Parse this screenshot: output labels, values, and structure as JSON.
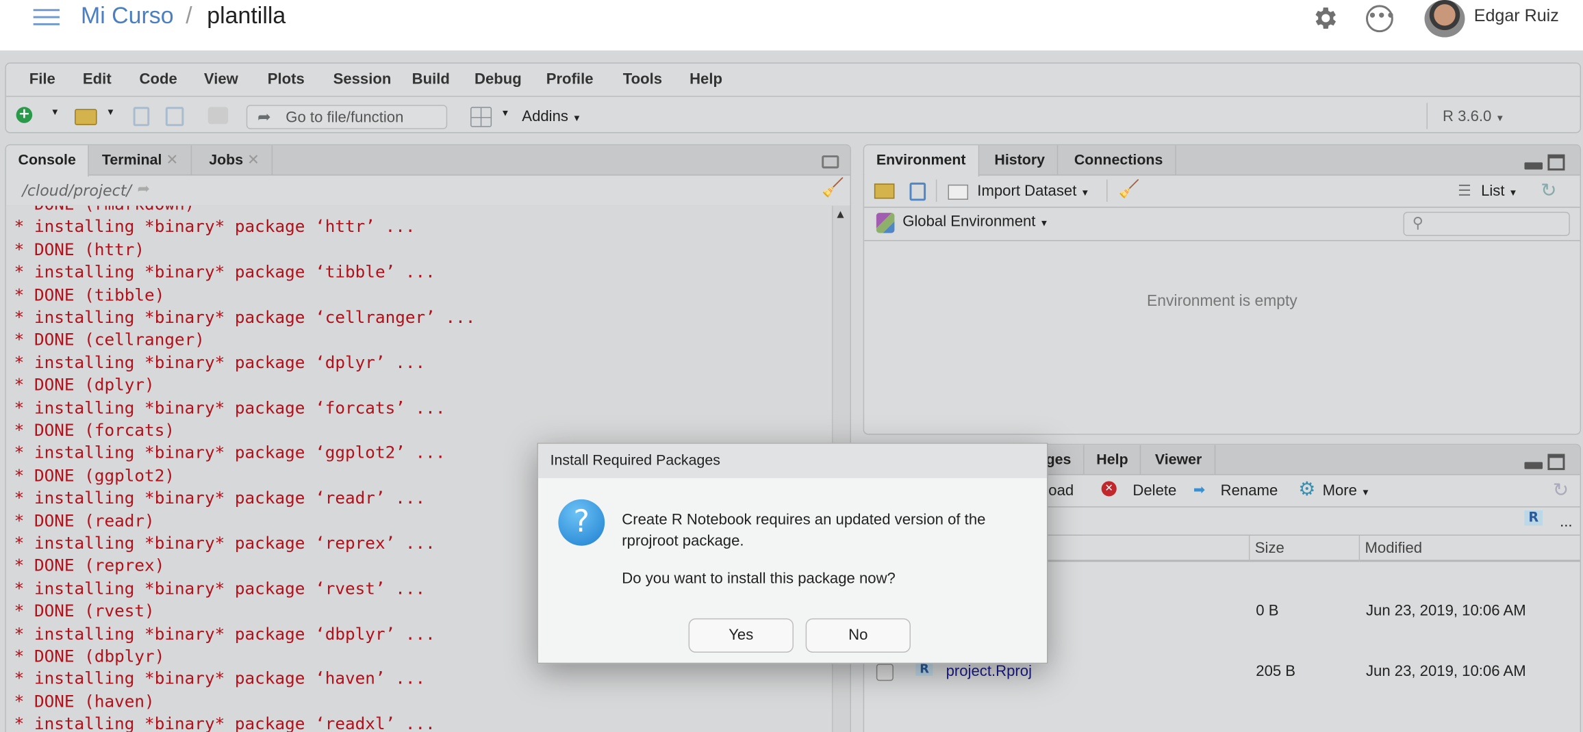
{
  "header": {
    "course": "Mi Curso",
    "separator": "/",
    "project": "plantilla",
    "user": "Edgar Ruiz"
  },
  "menu": [
    "File",
    "Edit",
    "Code",
    "View",
    "Plots",
    "Session",
    "Build",
    "Debug",
    "Profile",
    "Tools",
    "Help"
  ],
  "toolbar": {
    "goto_placeholder": "Go to file/function",
    "addins": "Addins",
    "r_version": "R 3.6.0"
  },
  "left_pane": {
    "tabs": [
      "Console",
      "Terminal",
      "Jobs"
    ],
    "path": "/cloud/project/",
    "console_lines": [
      "* DONE (rmarkdown)",
      "* installing *binary* package ‘httr’ ...",
      "* DONE (httr)",
      "* installing *binary* package ‘tibble’ ...",
      "* DONE (tibble)",
      "* installing *binary* package ‘cellranger’ ...",
      "* DONE (cellranger)",
      "* installing *binary* package ‘dplyr’ ...",
      "* DONE (dplyr)",
      "* installing *binary* package ‘forcats’ ...",
      "* DONE (forcats)",
      "* installing *binary* package ‘ggplot2’ ...",
      "* DONE (ggplot2)",
      "* installing *binary* package ‘readr’ ...",
      "* DONE (readr)",
      "* installing *binary* package ‘reprex’ ...",
      "* DONE (reprex)",
      "* installing *binary* package ‘rvest’ ...",
      "* DONE (rvest)",
      "* installing *binary* package ‘dbplyr’ ...",
      "* DONE (dbplyr)",
      "* installing *binary* package ‘haven’ ...",
      "* DONE (haven)",
      "* installing *binary* package ‘readxl’ ..."
    ]
  },
  "env_pane": {
    "tabs": [
      "Environment",
      "History",
      "Connections"
    ],
    "import_dataset": "Import Dataset",
    "list_view": "List",
    "scope": "Global Environment",
    "empty_message": "Environment is empty"
  },
  "files_pane": {
    "tabs": [
      "Packages",
      "Help",
      "Viewer"
    ],
    "toolbar": {
      "upload": "Upload",
      "delete": "Delete",
      "rename": "Rename",
      "more": "More"
    },
    "more_dots": "...",
    "columns": {
      "size": "Size",
      "modified": "Modified"
    },
    "rows": [
      {
        "name": "",
        "size": "0 B",
        "modified": "Jun 23, 2019, 10:06 AM"
      },
      {
        "name": "project.Rproj",
        "size": "205 B",
        "modified": "Jun 23, 2019, 10:06 AM"
      }
    ]
  },
  "dialog": {
    "title": "Install Required Packages",
    "line1": "Create R Notebook requires an updated version of the",
    "line2": "rprojroot package.",
    "question": "Do you want to install this package now?",
    "yes": "Yes",
    "no": "No"
  }
}
